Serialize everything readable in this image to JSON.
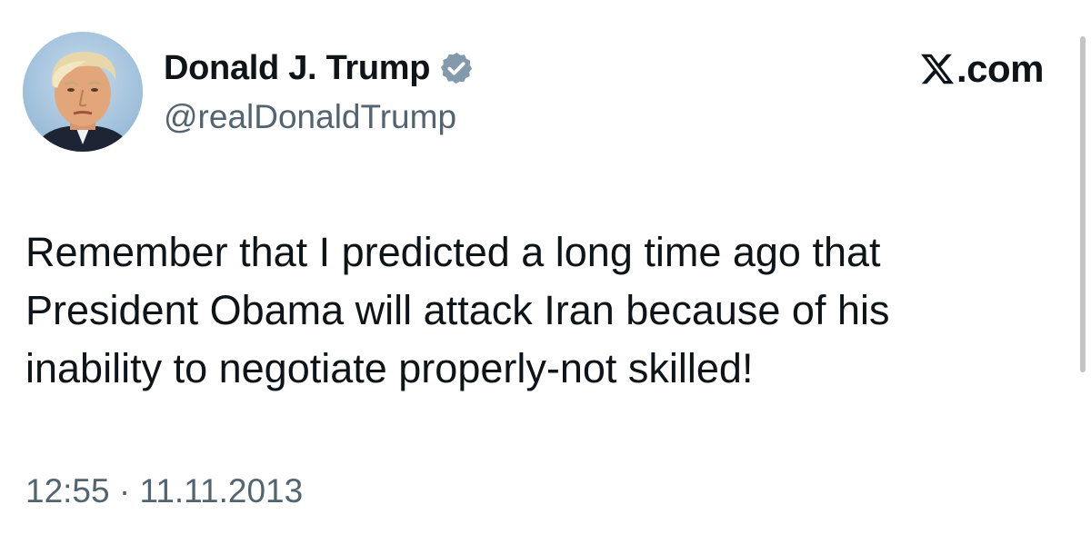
{
  "author": {
    "name": "Donald J. Trump",
    "handle": "@realDonaldTrump",
    "verified": true,
    "avatar_icon": "profile-photo"
  },
  "source": {
    "domain_suffix": ".com",
    "logo_icon": "x-logo-icon"
  },
  "tweet": {
    "text_lines": [
      "Remember that I predicted a long time ago that",
      "President Obama will attack Iran because of his",
      "inability to negotiate properly-not skilled!"
    ],
    "time": "12:55",
    "separator": "·",
    "date": "11.11.2013"
  },
  "colors": {
    "text_primary": "#0f1419",
    "text_secondary": "#536471",
    "verified_badge": "#829aab",
    "background": "#ffffff"
  }
}
